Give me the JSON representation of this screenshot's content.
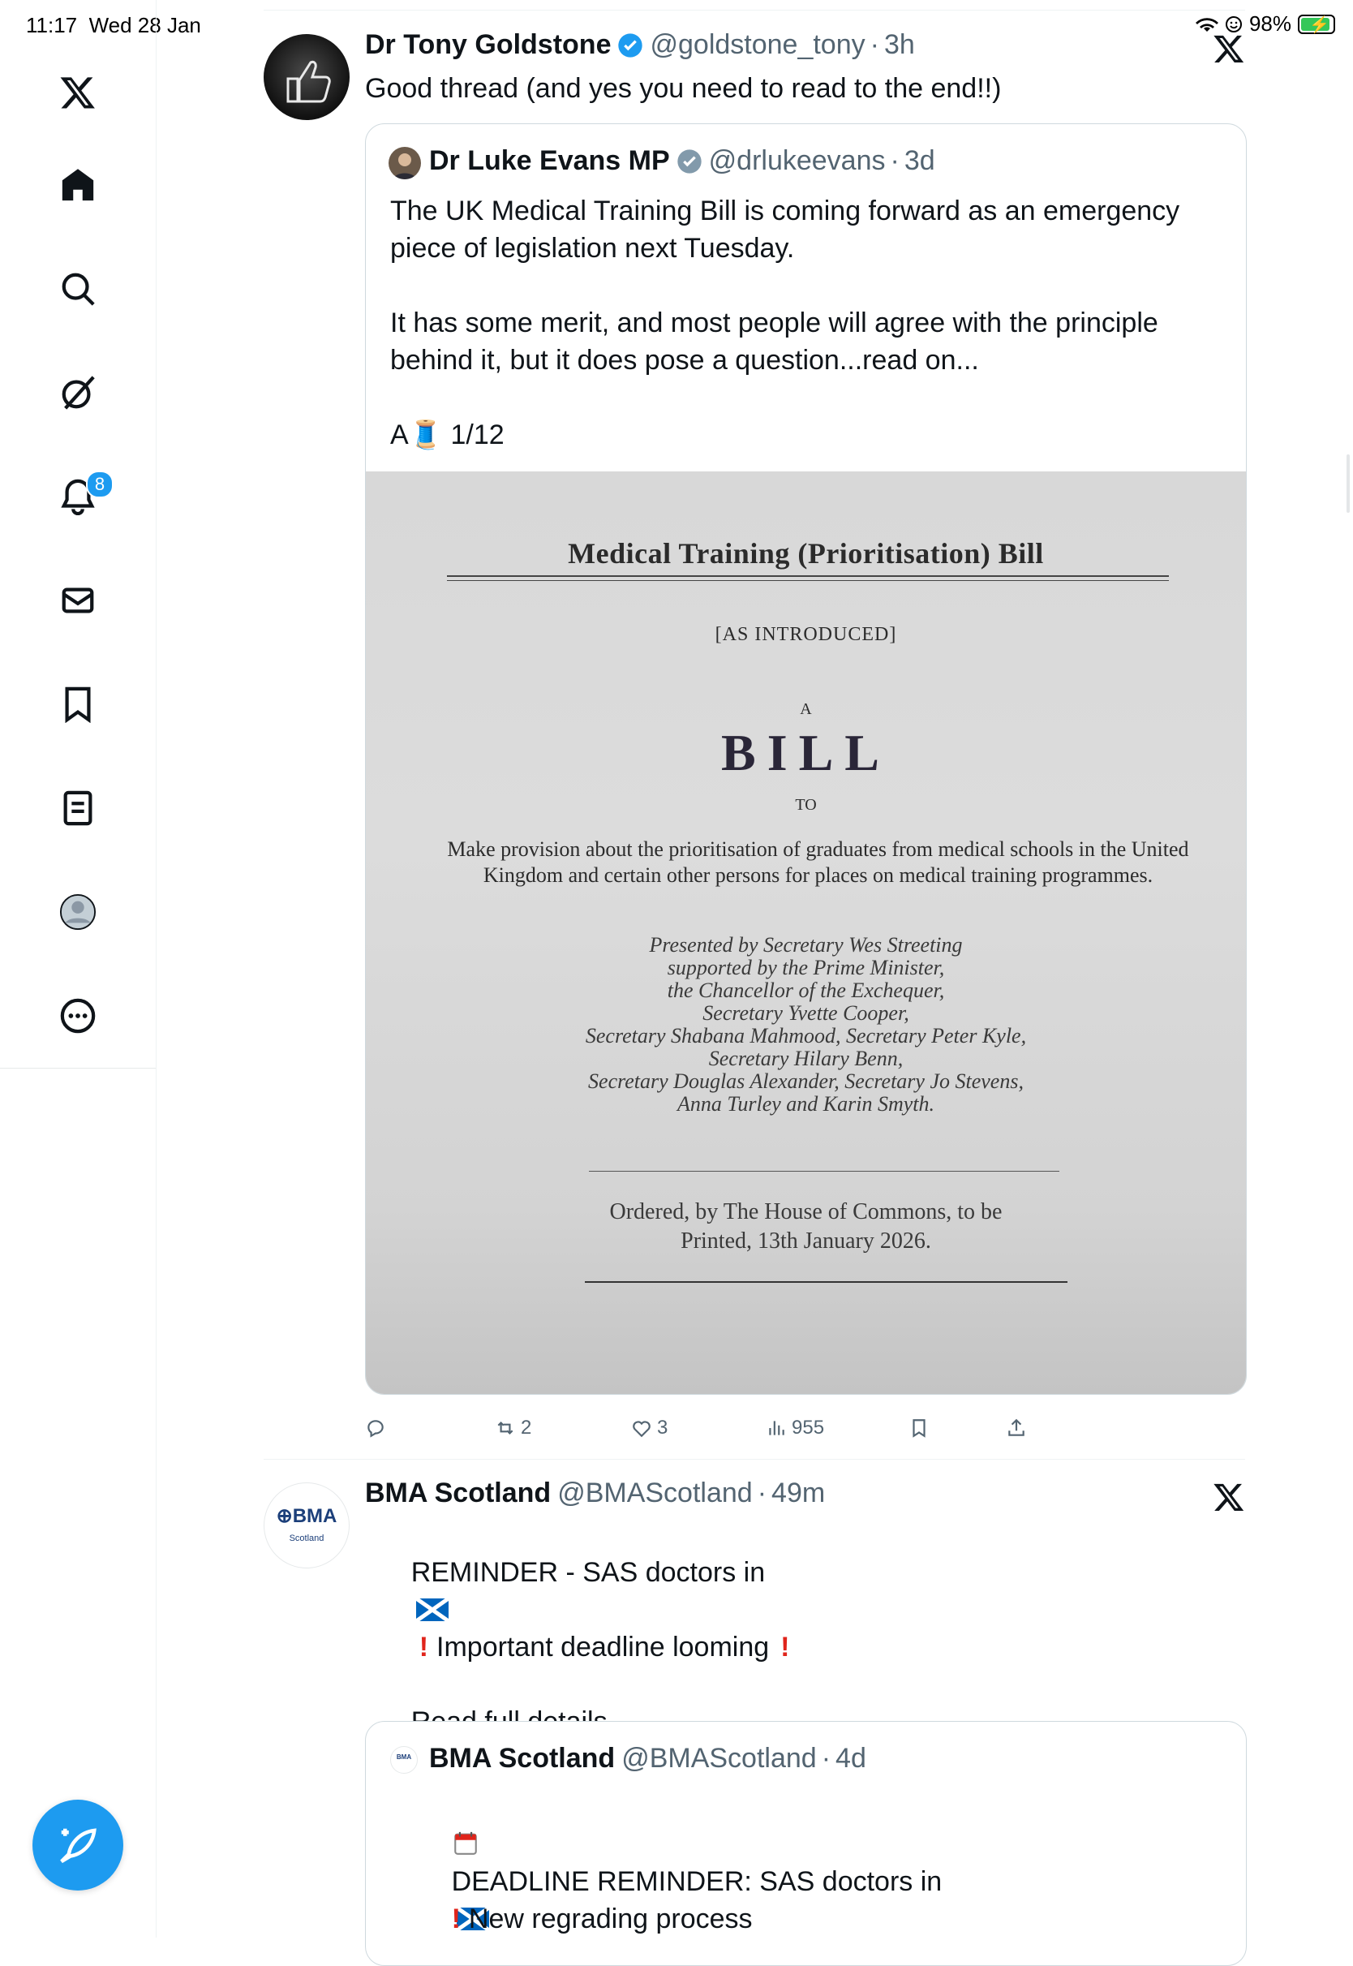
{
  "status_bar": {
    "time": "11:17",
    "date": "Wed 28 Jan",
    "battery": "98%"
  },
  "sidebar": {
    "items": [
      {
        "name": "x-logo"
      },
      {
        "name": "home"
      },
      {
        "name": "search"
      },
      {
        "name": "grok"
      },
      {
        "name": "notifications",
        "badge": "8"
      },
      {
        "name": "messages"
      },
      {
        "name": "bookmarks"
      },
      {
        "name": "lists"
      },
      {
        "name": "profile"
      },
      {
        "name": "more"
      }
    ]
  },
  "tweet1": {
    "name": "Dr Tony Goldstone",
    "handle": "@goldstone_tony",
    "time": "3h",
    "text": "Good thread (and yes you need to read to the end!!)",
    "quote": {
      "name": "Dr Luke Evans MP",
      "handle": "@drlukeevans",
      "time": "3d",
      "para1": "The UK Medical Training Bill is coming forward as an emergency piece of legislation next Tuesday.",
      "para2": "It has some merit, and most people will agree with the principle behind it, but it does pose a question...read on...",
      "para3_prefix": "A",
      "para3_emoji": "🧵",
      "para3_suffix": " 1/12",
      "image": {
        "title": "Medical Training (Prioritisation) Bill",
        "intro": "[AS INTRODUCED]",
        "a": "A",
        "bill": "BILL",
        "to": "TO",
        "desc": "Make provision about the prioritisation of graduates from medical schools in the United Kingdom and certain other persons for places on medical training programmes.",
        "presented": [
          "Presented by Secretary Wes Streeting",
          "supported by the Prime Minister,",
          "the Chancellor of the Exchequer,",
          "Secretary Yvette Cooper,",
          "Secretary Shabana Mahmood, Secretary Peter Kyle,",
          "Secretary Hilary Benn,",
          "Secretary Douglas Alexander, Secretary Jo Stevens,",
          "Anna Turley and Karin Smyth."
        ],
        "ordered_1": "Ordered, by The House of Commons, to be",
        "ordered_2": "Printed,  13th January 2026."
      }
    },
    "actions": {
      "replies": "",
      "reposts": "2",
      "likes": "3",
      "views": "955"
    }
  },
  "tweet2": {
    "avatar_text": "BMA",
    "avatar_sub": "Scotland",
    "name": "BMA Scotland",
    "handle": "@BMAScotland",
    "time": "49m",
    "line1": "REMINDER - SAS doctors in",
    "line2": "Important deadline looming",
    "line3": "Read full details",
    "quote": {
      "name": "BMA Scotland",
      "handle": "@BMAScotland",
      "time": "4d",
      "line1": "DEADLINE REMINDER: SAS doctors in",
      "line2": "New regrading process"
    }
  },
  "colors": {
    "accent": "#1d9bf0",
    "text": "#0f1419",
    "muted": "#536471",
    "border": "#cfd9de"
  }
}
